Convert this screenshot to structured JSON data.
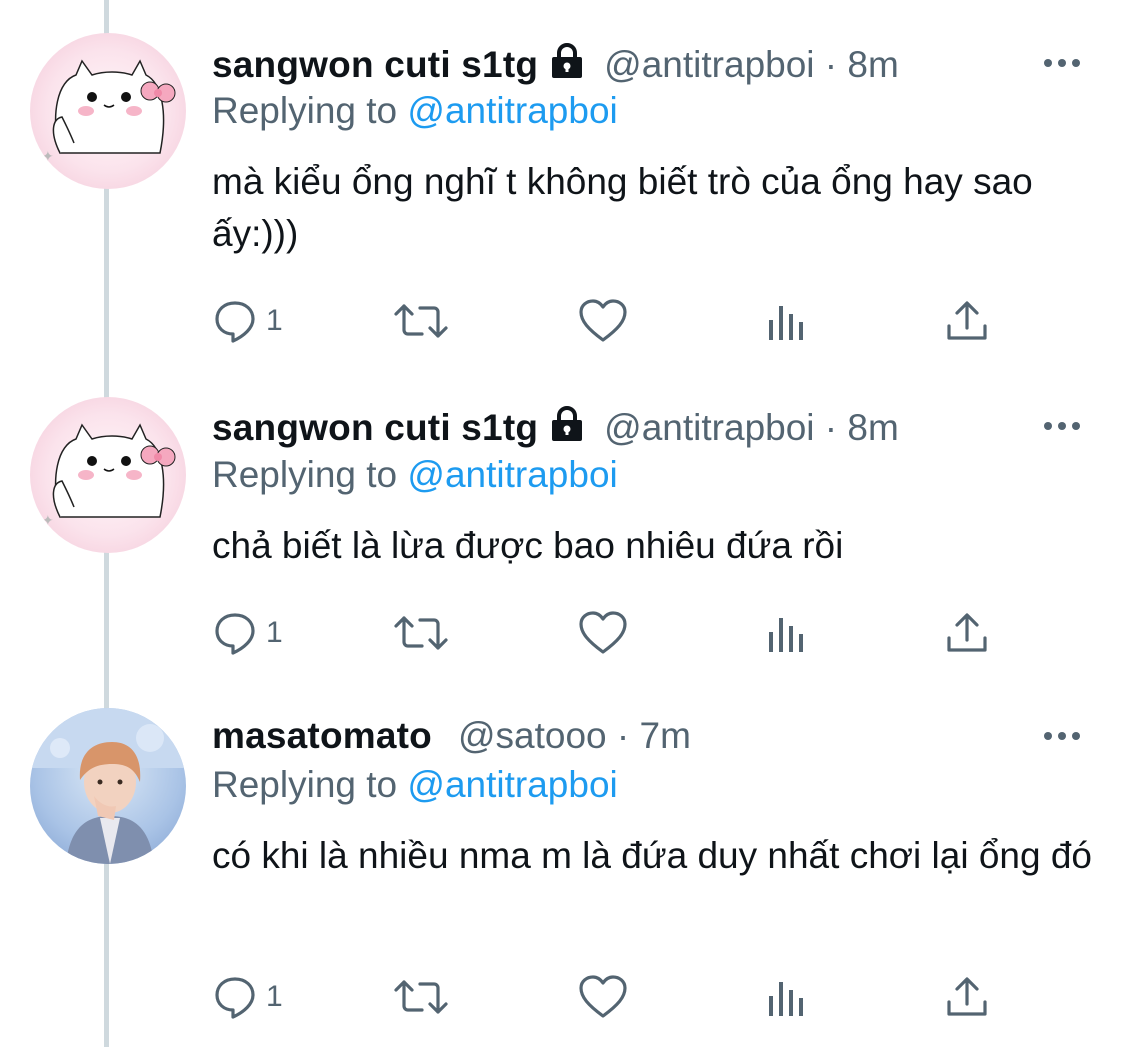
{
  "tweets": [
    {
      "name": "sangwon cuti s1tg",
      "handle": "@antitrapboi",
      "time": "8m",
      "reply_prefix": "Replying to ",
      "reply_to": "@antitrapboi",
      "text": "mà kiểu ổng nghĩ t không biết trò của ổng hay sao ấy:)))",
      "reply_count": "1",
      "protected": true,
      "avatar": "pink-cat-avatar"
    },
    {
      "name": "sangwon cuti s1tg",
      "handle": "@antitrapboi",
      "time": "8m",
      "reply_prefix": "Replying to ",
      "reply_to": "@antitrapboi",
      "text": "chả biết là lừa được bao nhiêu đứa rồi",
      "reply_count": "1",
      "protected": true,
      "avatar": "pink-cat-avatar"
    },
    {
      "name": "masatomato",
      "handle": "@satooo",
      "time": "7m",
      "reply_prefix": "Replying to ",
      "reply_to": "@antitrapboi",
      "text": "có khi là nhiều nma m là đứa duy nhất chơi lại ổng đó",
      "reply_count": "1",
      "protected": false,
      "avatar": "person-photo-avatar"
    }
  ],
  "separator": " · ",
  "colors": {
    "mention": "#1d9bf0",
    "secondary": "#536471",
    "thread_line": "#cfd9de"
  },
  "icons": [
    "reply-icon",
    "retweet-icon",
    "like-icon",
    "views-icon",
    "share-icon",
    "more-icon",
    "lock-icon"
  ]
}
